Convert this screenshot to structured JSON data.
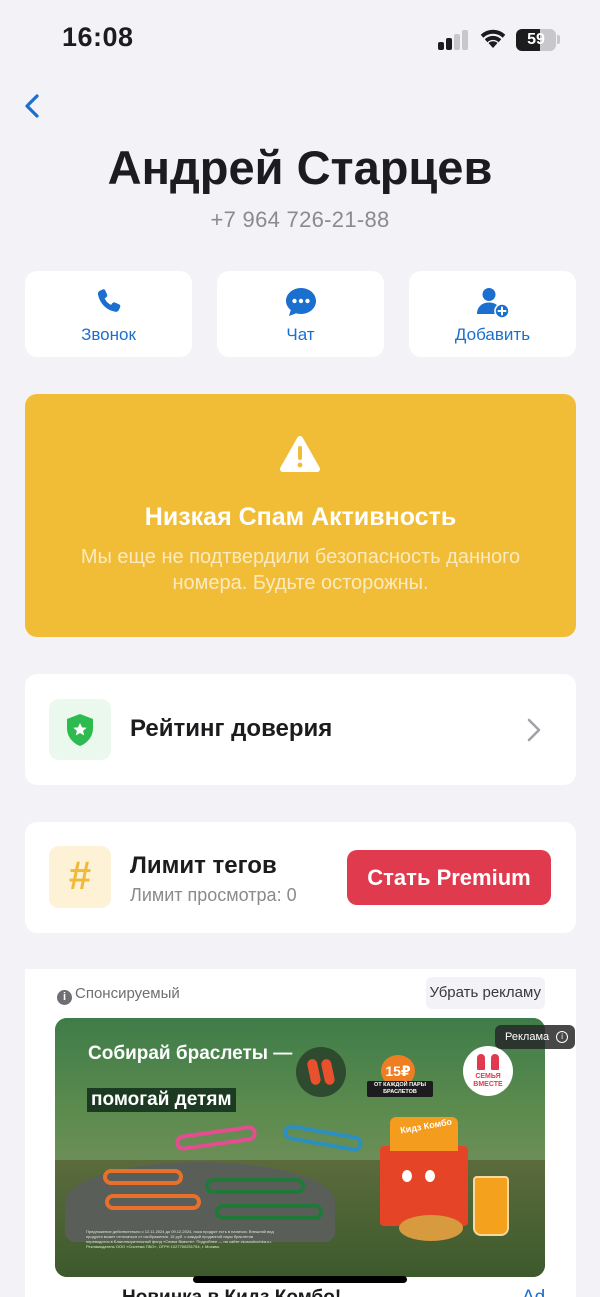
{
  "status_bar": {
    "time": "16:08",
    "battery_level": "59",
    "battery_fraction": 0.59,
    "signal_bars_active": 2,
    "signal_bars_total": 4
  },
  "nav": {
    "back_icon": "chevron-left-icon"
  },
  "contact": {
    "name": "Андрей Старцев",
    "phone": "+7 964 726-21-88"
  },
  "actions": [
    {
      "label": "Звонок",
      "icon": "phone-icon"
    },
    {
      "label": "Чат",
      "icon": "chat-bubble-icon"
    },
    {
      "label": "Добавить",
      "icon": "add-person-icon"
    }
  ],
  "spam": {
    "icon": "warning-triangle-icon",
    "title": "Низкая Спам Активность",
    "text": "Мы еще не подтвердили безопасность данного номера. Будьте осторожны.",
    "color": "#f1bd37"
  },
  "trust": {
    "icon": "shield-star-icon",
    "label": "Рейтинг доверия"
  },
  "tags": {
    "icon": "hashtag-icon",
    "icon_glyph": "#",
    "title": "Лимит тегов",
    "subtitle": "Лимит просмотра: 0",
    "premium_button": "Стать Premium",
    "premium_color": "#e03a4e"
  },
  "ad": {
    "sponsored_label": "Спонсируемый",
    "remove_label": "Убрать рекламу",
    "marker_label": "Реклама",
    "banner": {
      "headline": "Собирай браслеты —",
      "headline_highlight": "помогай детям",
      "price": "15₽",
      "price_note": "ОТ КАЖДОЙ ПАРЫ БРАСЛЕТОВ",
      "family_label": "СЕМЬЯ ВМЕСТЕ",
      "box_label": "Кидз Комбо",
      "disclaimer": "Предложение действительно с 12.11.2024 до 09.12.2024, пока продукт есть в наличии. Внешний вид продукта может отличаться от изображения. 15 руб. с каждой проданной пары браслетов переводятся в Благотворительный фонд «Семья Вместе». Подробнее — на сайте vkusnoitochka.ru. Рекламодатель ООО «Система ПБО», ОГРН 1027700251754, г. Москва."
    },
    "caption": "Новинка в Кидз Комбо!",
    "caption_right": "Ad"
  },
  "colors": {
    "accent": "#1a6fcf",
    "background": "#f2f2f7",
    "trust_green": "#2dba4e"
  }
}
